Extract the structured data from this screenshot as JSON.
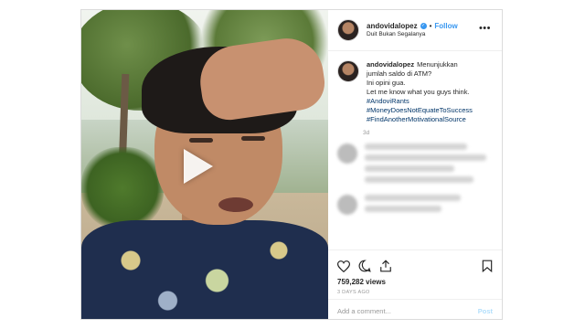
{
  "header": {
    "username": "andovidalopez",
    "follow_label": "Follow",
    "separator": "•",
    "location": "Duit Bukan Segalanya",
    "more_label": "•••"
  },
  "caption": {
    "username": "andovidalopez",
    "lines": [
      "Menunjukkan",
      "jumlah saldo di ATM?",
      "Ini opini gua.",
      "Let me know what you guys think."
    ],
    "hashtags": [
      "#AndoviRants",
      "#MoneyDoesNotEquateToSuccess",
      "#FindAnotherMotivationalSource"
    ],
    "age": "3d"
  },
  "stats": {
    "views": "759,282 views",
    "date": "3 DAYS AGO"
  },
  "comment_box": {
    "placeholder": "Add a comment...",
    "post_label": "Post"
  },
  "colors": {
    "accent": "#3897f0",
    "hashtag": "#003569",
    "muted": "#999999"
  },
  "icons": [
    "heart-icon",
    "comment-icon",
    "share-icon",
    "bookmark-icon",
    "play-icon",
    "verified-icon"
  ]
}
